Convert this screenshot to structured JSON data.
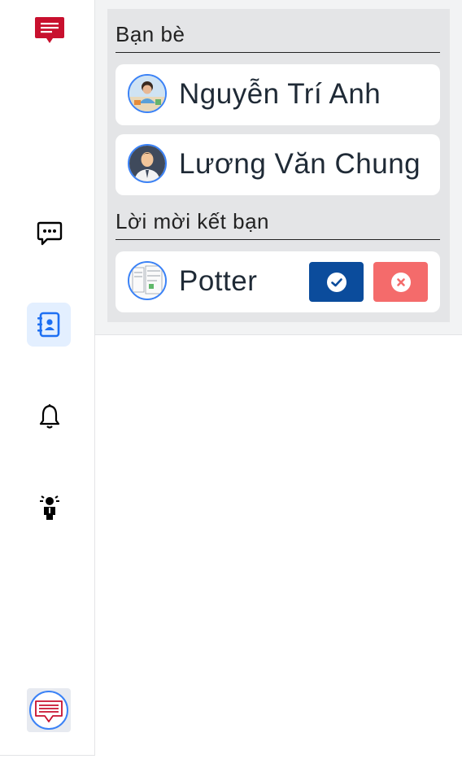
{
  "sidebar": {
    "items": [
      {
        "icon": "chat-logo-icon"
      },
      {
        "icon": "message-icon"
      },
      {
        "icon": "contacts-book-icon",
        "active": true
      },
      {
        "icon": "bell-icon"
      },
      {
        "icon": "user-alert-icon"
      },
      {
        "icon": "profile-avatar-icon"
      }
    ],
    "accent": "#c8102e",
    "active_bg": "#e3efff",
    "active_icon": "#1d6ff2"
  },
  "friends": {
    "title": "Bạn bè",
    "list": [
      {
        "name": "Nguyễn Trí Anh"
      },
      {
        "name": "Lương Văn Chung"
      }
    ]
  },
  "requests": {
    "title": "Lời mời kết bạn",
    "list": [
      {
        "name": "Potter",
        "accept_icon": "check-circle-icon",
        "reject_icon": "x-circle-icon"
      }
    ],
    "accept_color": "#0b4c9c",
    "reject_color": "#f46b6b"
  }
}
